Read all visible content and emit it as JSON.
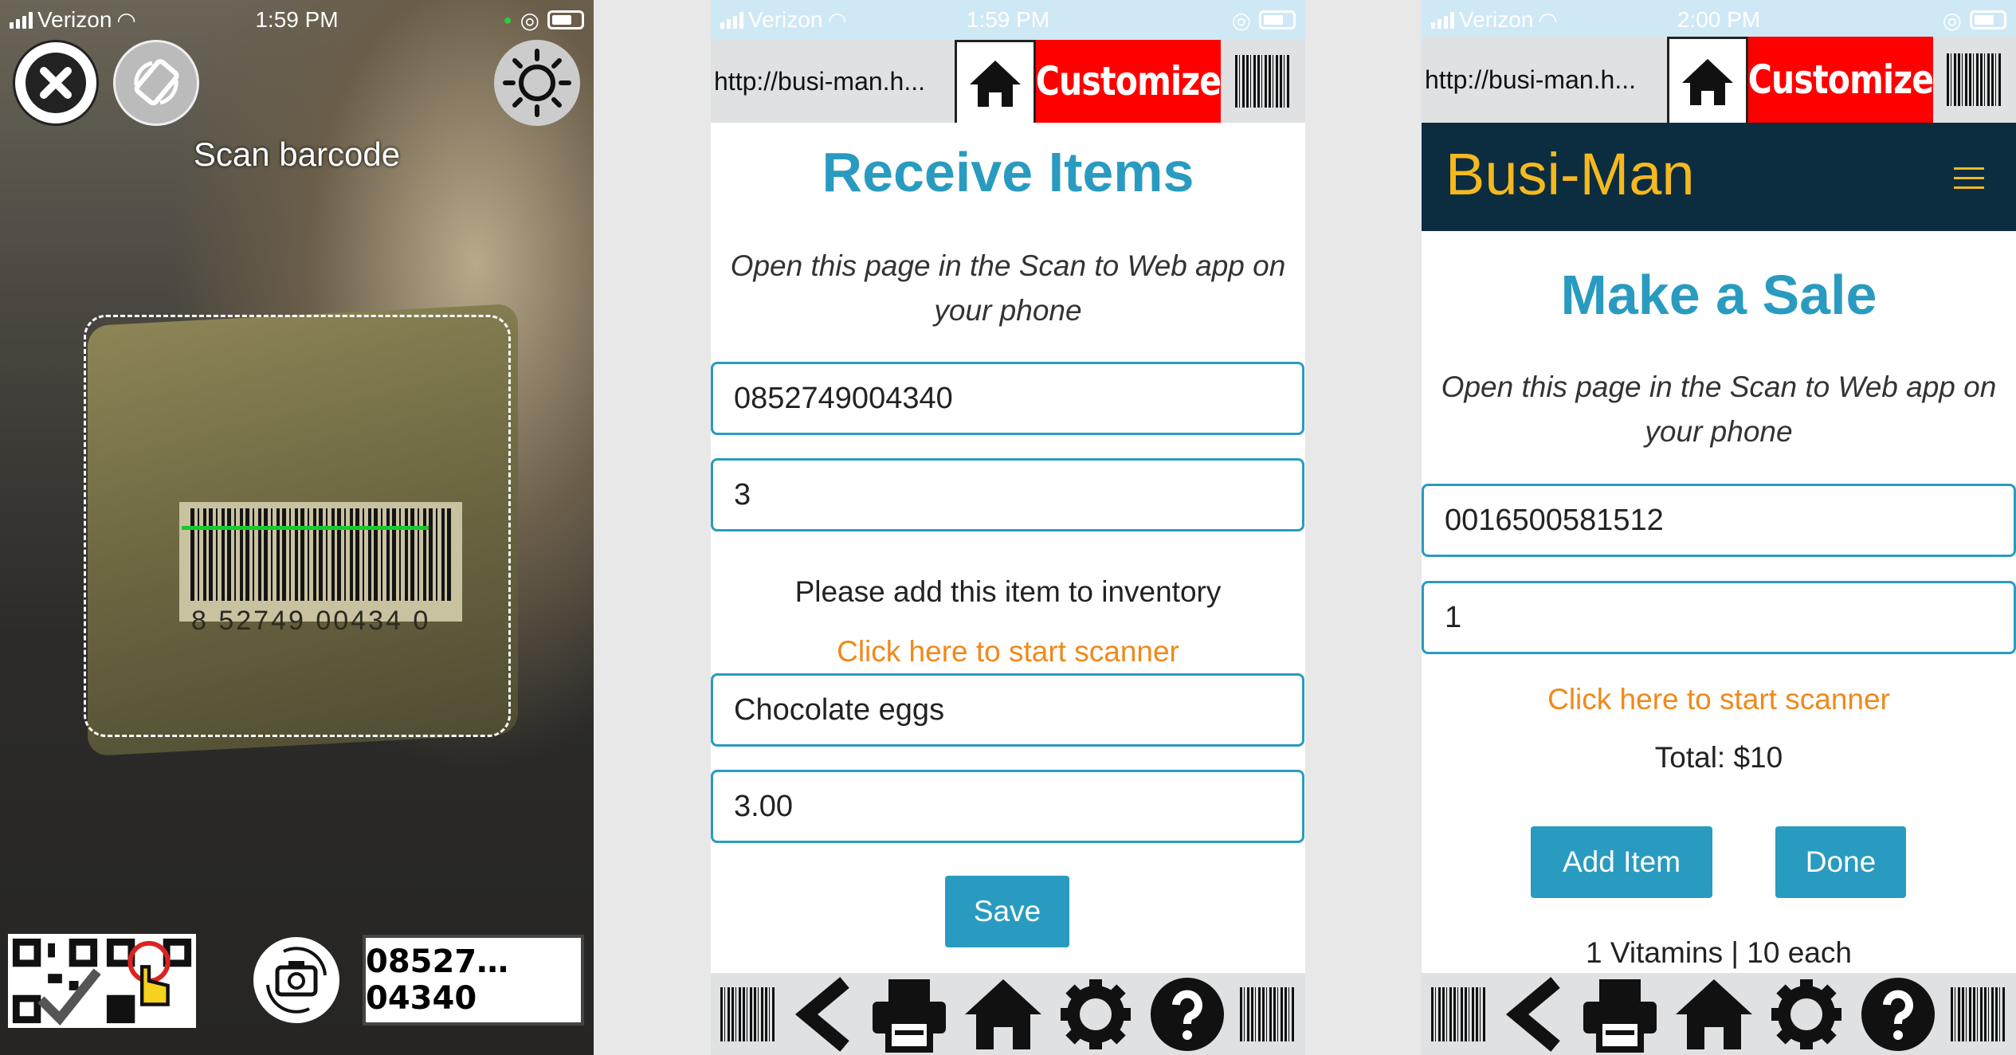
{
  "status_left": {
    "carrier": "Verizon",
    "time": "1:59 PM"
  },
  "status_mid": {
    "carrier": "Verizon",
    "time": "1:59 PM"
  },
  "status_right": {
    "carrier": "Verizon",
    "time": "2:00 PM"
  },
  "scanner": {
    "title": "Scan barcode",
    "scanned_code": "08527…04340",
    "barcode_digits": "8  52749 00434  0",
    "icons": [
      "close-icon",
      "rotate-icon",
      "flashlight-icon",
      "qr-mode-icon",
      "camera-switch-icon"
    ]
  },
  "browser": {
    "url": "http://busi-man.h...",
    "customize_label": "Customize"
  },
  "receive_page": {
    "title": "Receive Items",
    "subtitle_line1": "Open this page in the Scan to Web app on",
    "subtitle_line2": "your phone",
    "barcode_value": "0852749004340",
    "quantity_value": "3",
    "notice": "Please add this item to inventory",
    "scanner_link": "Click here to start scanner",
    "item_name_value": "Chocolate eggs",
    "price_value": "3.00",
    "save_label": "Save"
  },
  "sale_page": {
    "brand": "Busi-Man",
    "title": "Make a Sale",
    "subtitle_line1": "Open this page in the Scan to Web app on",
    "subtitle_line2": "your phone",
    "barcode_value": "0016500581512",
    "quantity_value": "1",
    "scanner_link": "Click here to start scanner",
    "total": "Total: $10",
    "add_item_label": "Add Item",
    "done_label": "Done",
    "line_item": "1 Vitamins | 10 each"
  },
  "colors": {
    "accent": "#2a9bc0",
    "link": "#f0891a",
    "brand": "#f5b81f",
    "navbar": "#0b2d3f",
    "customize": "#ff0000"
  }
}
